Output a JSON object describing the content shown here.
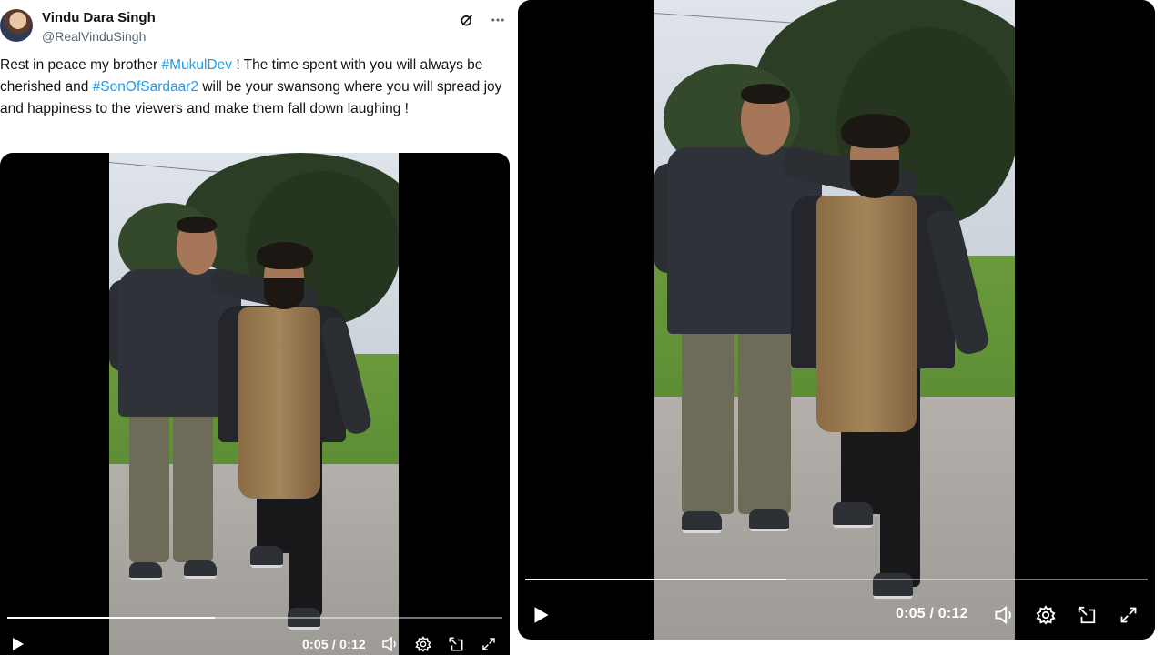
{
  "tweet": {
    "author_name": "Vindu Dara Singh",
    "author_handle": "@RealVinduSingh",
    "text_segments": [
      {
        "text": "Rest in peace my brother ",
        "tag": false
      },
      {
        "text": "#MukulDev",
        "tag": true
      },
      {
        "text": " ! The time spent with you will always be cherished and ",
        "tag": false
      },
      {
        "text": "#SonOfSardaar2",
        "tag": true
      },
      {
        "text": " will be your swansong where you will spread joy and happiness to the viewers and make them fall down laughing !",
        "tag": false
      }
    ],
    "icons": [
      "grok-icon",
      "more-icon"
    ]
  },
  "video_left": {
    "time": "0:05 / 0:12",
    "progress": 0.42,
    "controls": [
      "play-icon",
      "volume-icon",
      "settings-icon",
      "pip-icon",
      "fullscreen-icon"
    ]
  },
  "video_right": {
    "time": "0:05 / 0:12",
    "progress": 0.42,
    "controls": [
      "play-icon",
      "volume-icon",
      "settings-icon",
      "pip-icon",
      "fullscreen-icon"
    ]
  },
  "colors": {
    "hashtag": "#1d9bf0",
    "handle": "#536471",
    "text": "#0f1419",
    "video_bg": "#000000"
  }
}
